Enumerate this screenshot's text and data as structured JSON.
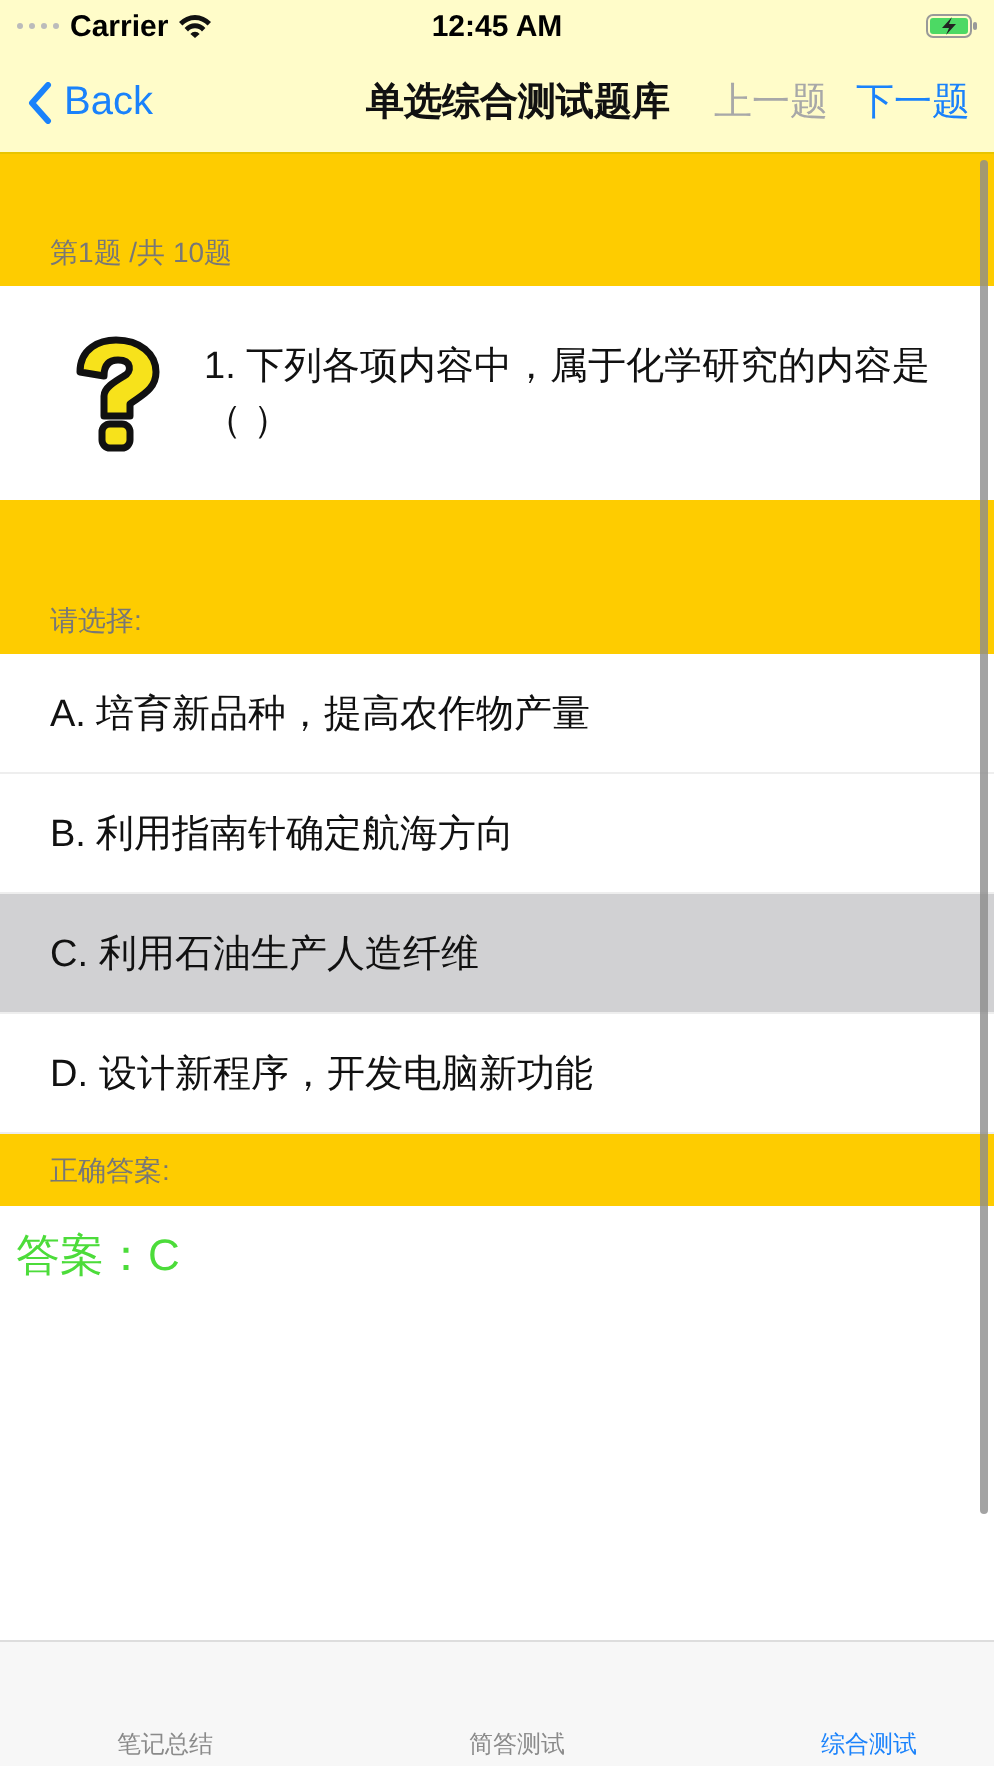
{
  "status_bar": {
    "carrier": "Carrier",
    "time": "12:45 AM"
  },
  "nav": {
    "back": "Back",
    "title": "单选综合测试题库",
    "buttons": [
      {
        "label": "上一题",
        "disabled": true
      },
      {
        "label": "下一题",
        "disabled": false
      }
    ]
  },
  "progress": "第1题 /共 10题",
  "question": "1.  下列各项内容中，属于化学研究的内容是（  ）",
  "choose_label": "请选择:",
  "options": [
    {
      "label": "A.  培育新品种，提高农作物产量",
      "selected": false
    },
    {
      "label": "B.  利用指南针确定航海方向",
      "selected": false
    },
    {
      "label": "C.  利用石油生产人造纤维",
      "selected": true
    },
    {
      "label": "D.  设计新程序，开发电脑新功能",
      "selected": false
    }
  ],
  "answer_label": "正确答案:",
  "answer": "答案：C",
  "tabs": [
    {
      "label": "笔记总结",
      "selected": false
    },
    {
      "label": "简答测试",
      "selected": false
    },
    {
      "label": "综合测试",
      "selected": true
    }
  ]
}
